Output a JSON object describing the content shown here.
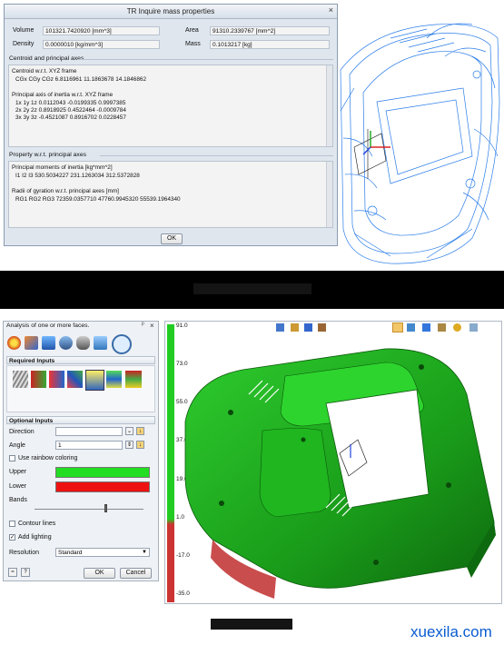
{
  "mass_dialog": {
    "title": "TR Inquire mass properties",
    "close_glyph": "×",
    "volume_label": "Volume",
    "volume_value": "101321.7420920 [mm^3]",
    "area_label": "Area",
    "area_value": "91310.2339767 [mm^2]",
    "density_label": "Density",
    "density_value": "0.0000010 [kg/mm^3]",
    "mass_label": "Mass",
    "mass_value": "0.1013217 [kg]",
    "centroid_group": "Centroid and principal axes",
    "centroid_lines": [
      "Centroid w.r.t. XYZ frame",
      "CGx CGy CGz   6.8116961   11.1863678 14.1846862",
      "",
      "Principal axis of inertia w.r.t. XYZ frame",
      "1x  1y  1z   0.0112043   -0.0199335   0.9997385",
      "2x  2y  2z   0.8918925   0.4522464   -0.0009784",
      "3x  3y  3z   -0.4521087   0.8916702   0.0228457"
    ],
    "property_group": "Property w.r.t. principal axes",
    "property_lines": [
      "Principal moments of inertia [kg*mm^2]",
      "I1  I2  I3   530.5034227   231.1263034   312.5372828",
      "",
      "Radii of gyration w.r.t. principal axes [mm]",
      "RG1 RG2 RG3   72359.0357710   47760.9945320   55539.1964340"
    ],
    "ok_label": "OK"
  },
  "analysis_panel": {
    "title": "Analysis of one or more faces.",
    "pin_glyph": "ᵖ",
    "close_glyph": "×",
    "required_inputs": "Required Inputs",
    "optional_inputs": "Optional Inputs",
    "direction_label": "Direction",
    "direction_value": "",
    "angle_label": "Angle",
    "angle_value": "1",
    "rainbow_label": "Use rainbow coloring",
    "upper_label": "Upper",
    "lower_label": "Lower",
    "bands_label": "Bands",
    "contour_label": "Contour lines",
    "lighting_label": "Add lighting",
    "resolution_label": "Resolution",
    "resolution_value": "Standard",
    "ok_label": "OK",
    "cancel_label": "Cancel",
    "upper_color": "#22dd22",
    "lower_color": "#ee1111"
  },
  "color_scale": {
    "labels": [
      "91.0",
      "73.0",
      "55.0",
      "37.0",
      "19.0",
      "1.0",
      "-17.0",
      "-35.0"
    ]
  },
  "watermark": "xuexila.com"
}
